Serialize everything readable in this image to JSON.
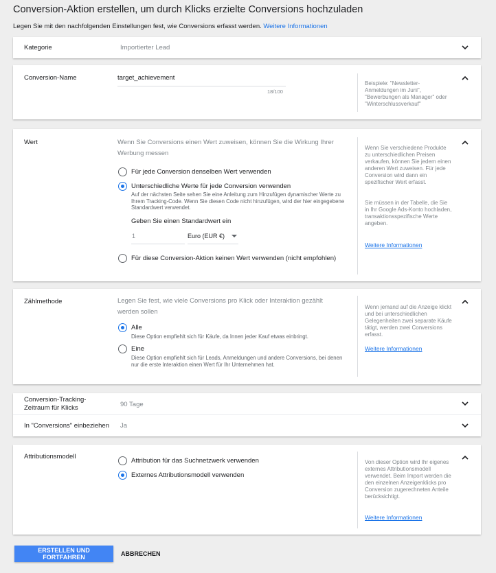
{
  "page": {
    "title": "Conversion-Aktion erstellen, um durch Klicks erzielte Conversions hochzuladen",
    "intro_text": "Legen Sie mit den nachfolgenden Einstellungen fest, wie Conversions erfasst werden.",
    "intro_link": "Weitere Informationen"
  },
  "kategorie": {
    "label": "Kategorie",
    "value": "Importierter Lead"
  },
  "conversion_name": {
    "label": "Conversion-Name",
    "value": "target_achievement",
    "counter": "18/100",
    "help": "Beispiele: \"Newsletter-Anmeldungen im Juni\", \"Bewerbungen als Manager\" oder \"Winterschlussverkauf\""
  },
  "wert": {
    "label": "Wert",
    "description": "Wenn Sie Conversions einen Wert zuweisen, können Sie die Wirkung Ihrer Werbung messen",
    "option1": "Für jede Conversion denselben Wert verwenden",
    "option2": "Unterschiedliche Werte für jede Conversion verwenden",
    "option2_hint": "Auf der nächsten Seite sehen Sie eine Anleitung zum Hinzufügen dynamischer Werte zu Ihrem Tracking-Code. Wenn Sie diesen Code nicht hinzufügen, wird der hier eingegebene Standardwert verwendet.",
    "default_label": "Geben Sie einen Standardwert ein",
    "default_value": "1",
    "currency": "Euro (EUR €)",
    "option3": "Für diese Conversion-Aktion keinen Wert verwenden (nicht empfohlen)",
    "help1": "Wenn Sie verschiedene Produkte zu unterschiedlichen Preisen verkaufen, können Sie jedem einen anderen Wert zuweisen. Für jede Conversion wird dann ein spezifischer Wert erfasst.",
    "help2": "Sie müssen in der Tabelle, die Sie in Ihr Google Ads-Konto hochladen, transaktionsspezifische Werte angeben.",
    "help_link": "Weitere Informationen"
  },
  "zaehlmethode": {
    "label": "Zählmethode",
    "description": "Legen Sie fest, wie viele Conversions pro Klick oder Interaktion gezählt werden sollen",
    "option1": "Alle",
    "option1_hint": "Diese Option empfiehlt sich für Käufe, da Innen jeder Kauf etwas einbringt.",
    "option2": "Eine",
    "option2_hint": "Diese Option empfiehlt sich für Leads, Anmeldungen und andere Conversions, bei denen nur die erste Interaktion einen Wert für Ihr Unternehmen hat.",
    "help": "Wenn jemand auf die Anzeige klickt und bei unterschiedlichen Gelegenheiten zwei separate Käufe tätigt, werden zwei Conversions erfasst.",
    "help_link": "Weitere Informationen"
  },
  "tracking": {
    "label": "Conversion-Tracking-Zeitraum für Klicks",
    "value": "90 Tage"
  },
  "einbeziehen": {
    "label": "In \"Conversions\" einbeziehen",
    "value": "Ja"
  },
  "attribution": {
    "label": "Attributionsmodell",
    "option1": "Attribution für das Suchnetzwerk verwenden",
    "option2": "Externes Attributionsmodell verwenden",
    "help": "Von dieser Option wird Ihr eigenes externes Attributionsmodell verwendet. Beim Import werden die den einzelnen Anzeigenklicks pro Conversion zugerechneten Anteile berücksichtigt.",
    "help_link": "Weitere Informationen"
  },
  "actions": {
    "create": "ERSTELLEN UND FORTFAHREN",
    "cancel": "ABBRECHEN"
  },
  "colors": {
    "accent": "#1a73e8",
    "primary_button": "#4285f4"
  }
}
